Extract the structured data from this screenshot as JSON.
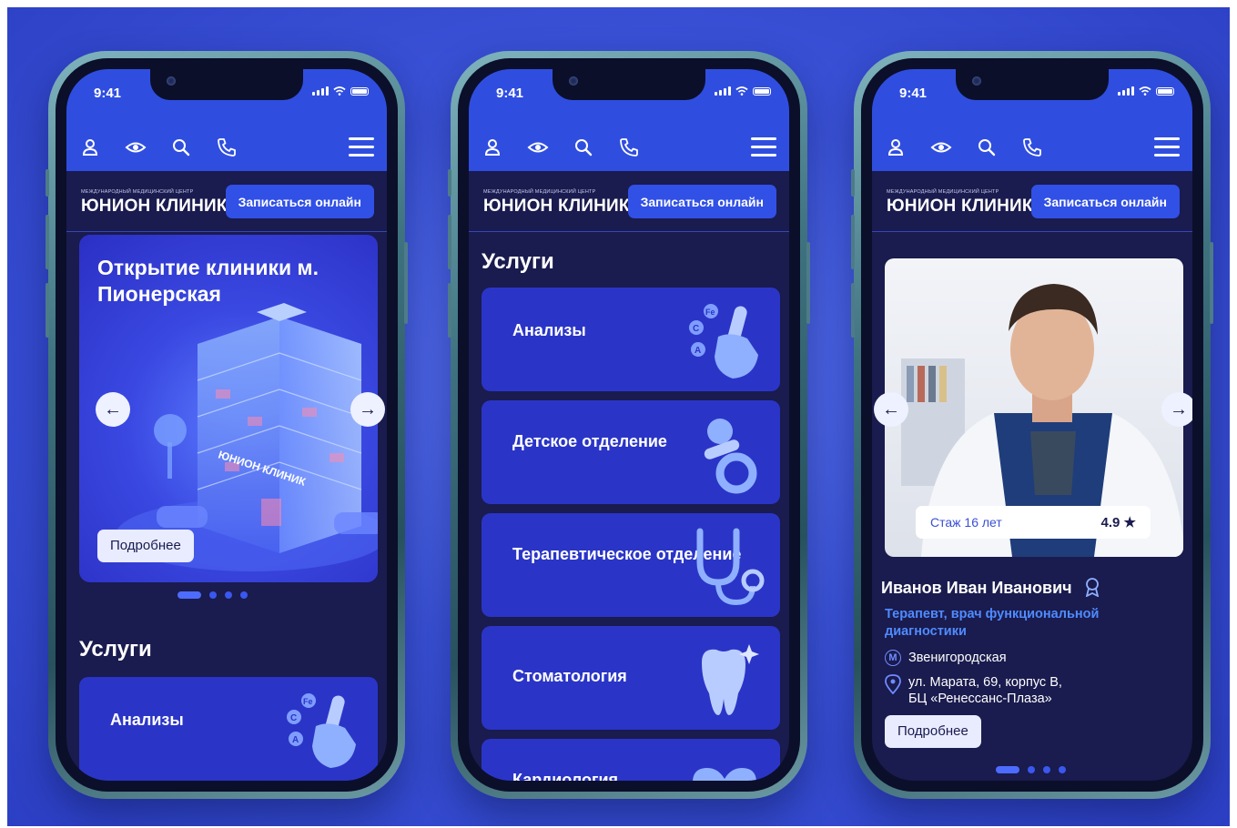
{
  "status": {
    "time": "9:41"
  },
  "header": {
    "brand_small": "МЕЖДУНАРОДНЫЙ МЕДИЦИНСКИЙ ЦЕНТР",
    "brand_name": "ЮНИОН КЛИНИК",
    "cta_label": "Записаться онлайн",
    "icons": [
      "user-icon",
      "eye-icon",
      "search-icon",
      "phone-icon",
      "menu-icon"
    ]
  },
  "screen1": {
    "banner_title": "Открытие клиники м. Пионерская",
    "banner_building_sign": "ЮНИОН КЛИНИК",
    "banner_button": "Подробнее",
    "slides_total": 4,
    "slide_active": 1,
    "services_title": "Услуги",
    "first_service": "Анализы"
  },
  "screen2": {
    "services_title": "Услуги",
    "services": [
      {
        "label": "Анализы",
        "icon": "test-tube-hand-icon"
      },
      {
        "label": "Детское отделение",
        "icon": "pacifier-icon"
      },
      {
        "label": "Терапевтическое отделение",
        "icon": "stethoscope-icon"
      },
      {
        "label": "Стоматология",
        "icon": "tooth-icon"
      },
      {
        "label": "Кардиология",
        "icon": "heart-icon"
      }
    ]
  },
  "screen3": {
    "experience": "Стаж 16 лет",
    "rating": "4.9",
    "doctor_name": "Иванов Иван Иванович",
    "specialty": "Терапевт, врач функциональной диагностики",
    "metro_badge": "М",
    "metro": "Звенигородская",
    "address_line1": "ул. Марата, 69, корпус В,",
    "address_line2": "БЦ «Ренессанс-Плаза»",
    "button": "Подробнее",
    "slides_total": 4,
    "slide_active": 1
  },
  "colors": {
    "brand_blue": "#2f4ee0",
    "background_dark": "#1a1b4e",
    "card_blue": "#2a35c7",
    "accent_light": "#4f8bff"
  }
}
